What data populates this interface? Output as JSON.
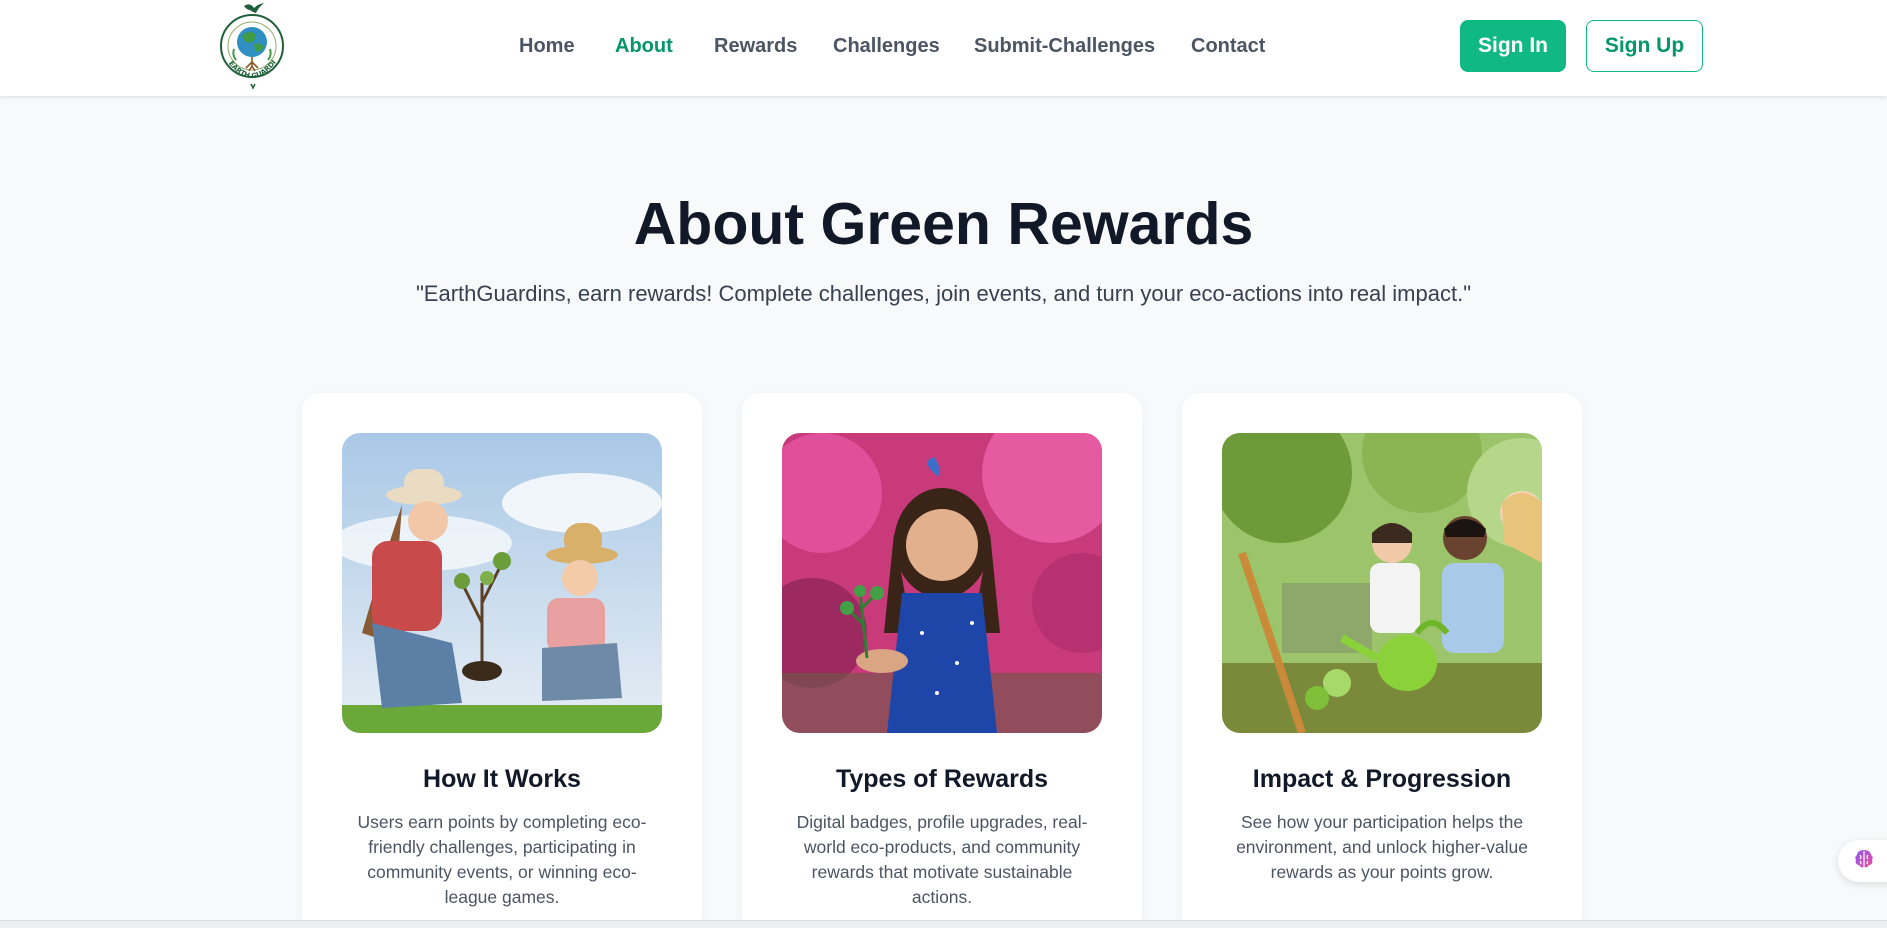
{
  "brand": {
    "logo_text": "EARTH GUARDIANS",
    "accent_color": "#10b981",
    "accent_dark": "#059669"
  },
  "nav": {
    "items": [
      {
        "label": "Home",
        "active": false
      },
      {
        "label": "About",
        "active": true
      },
      {
        "label": "Rewards",
        "active": false
      },
      {
        "label": "Challenges",
        "active": false
      },
      {
        "label": "Submit-Challenges",
        "active": false
      },
      {
        "label": "Contact",
        "active": false
      }
    ],
    "signin_label": "Sign In",
    "signup_label": "Sign Up"
  },
  "hero": {
    "title": "About Green Rewards",
    "subtitle": "\"EarthGuardins, earn rewards! Complete challenges, join events, and turn your eco-actions into real impact.\""
  },
  "cards": [
    {
      "image_icon": "mother-child-planting-photo",
      "title": "How It Works",
      "text": "Users earn points by completing eco-friendly challenges, participating in community events, or winning eco-league games."
    },
    {
      "image_icon": "girl-holding-seedling-photo",
      "title": "Types of Rewards",
      "text": "Digital badges, profile upgrades, real-world eco-products, and community rewards that motivate sustainable actions."
    },
    {
      "image_icon": "kids-gardening-photo",
      "title": "Impact & Progression",
      "text": "See how your participation helps the environment, and unlock higher-value rewards as your points grow."
    }
  ],
  "widget": {
    "icon": "brain-icon"
  }
}
